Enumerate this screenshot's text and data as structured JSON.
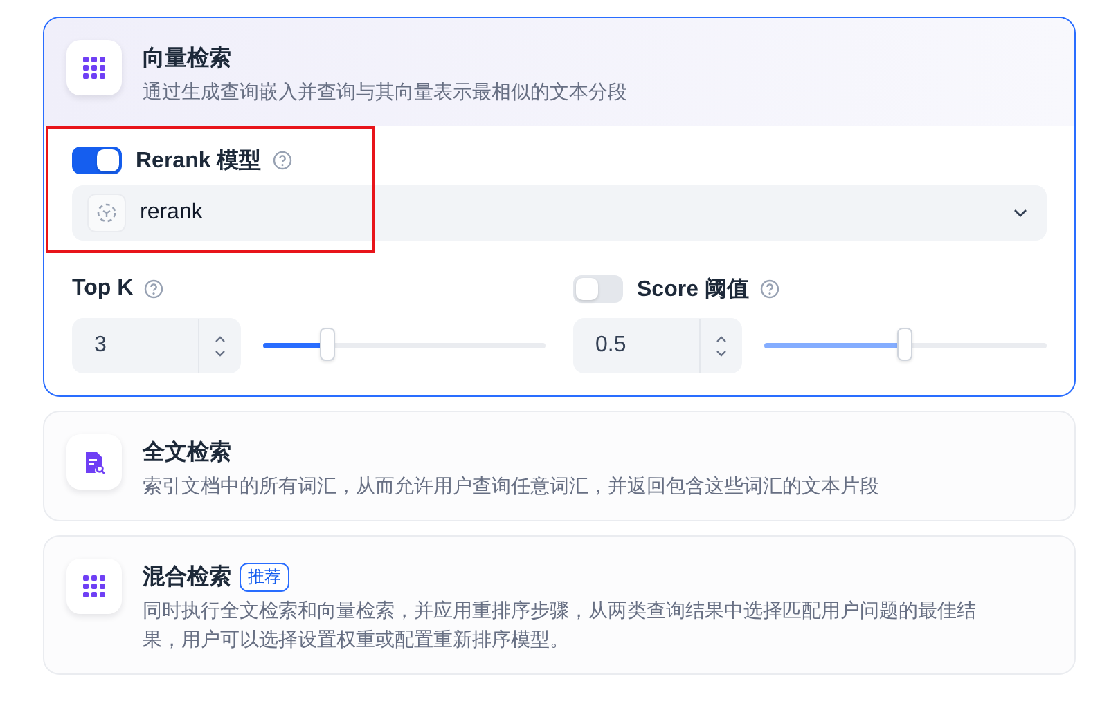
{
  "retrieval_modes": [
    {
      "kind": "vector",
      "selected": true,
      "title": "向量检索",
      "description": "通过生成查询嵌入并查询与其向量表示最相似的文本分段",
      "settings": {
        "rerank": {
          "label": "Rerank 模型",
          "enabled": true,
          "highlighted": true,
          "model": "rerank"
        },
        "top_k": {
          "label": "Top K",
          "value": "3",
          "level": 0.23
        },
        "score_threshold": {
          "label": "Score 阈值",
          "enabled": false,
          "value": "0.5",
          "level": 0.5
        }
      }
    },
    {
      "kind": "fulltext",
      "selected": false,
      "title": "全文检索",
      "description": "索引文档中的所有词汇，从而允许用户查询任意词汇，并返回包含这些词汇的文本片段"
    },
    {
      "kind": "hybrid",
      "selected": false,
      "title": "混合检索",
      "badge": "推荐",
      "description": "同时执行全文检索和向量检索，并应用重排序步骤，从两类查询结果中选择匹配用户问题的最佳结果，用户可以选择设置权重或配置重新排序模型。"
    }
  ]
}
